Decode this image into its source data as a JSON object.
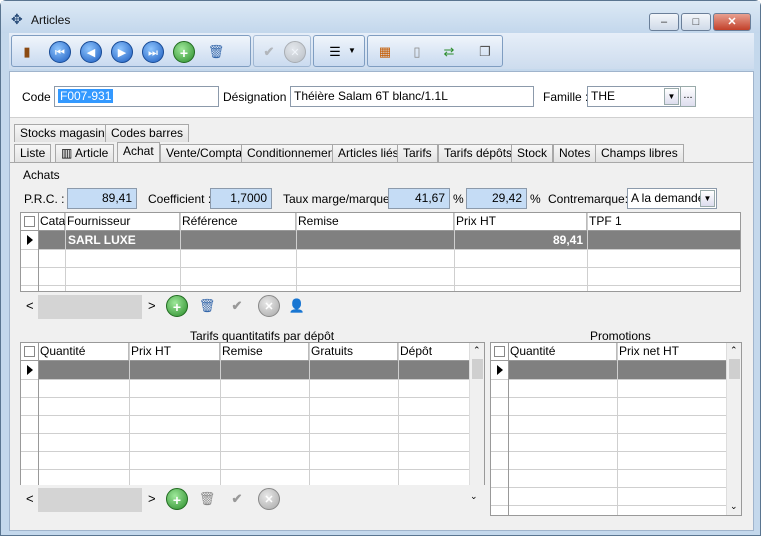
{
  "window": {
    "title": "Articles",
    "app_icon": "articles-app-icon"
  },
  "toolbar": {
    "icons": [
      "exit-door-icon",
      "first-record-icon",
      "previous-record-icon",
      "next-record-icon",
      "last-record-icon",
      "add-icon",
      "delete-icon",
      "validate-icon",
      "cancel-icon",
      "print-menu-icon",
      "stock-icon",
      "document-icon",
      "refresh-icon",
      "copy-icon"
    ]
  },
  "header": {
    "code_label": "Code :",
    "code_value": "F007-931",
    "designation_label": "Désignation :",
    "designation_value": "Théière Salam 6T blanc/1.1L",
    "famille_label": "Famille :",
    "famille_value": "THE",
    "more_button": "..."
  },
  "tabs_row1": [
    "Stocks magasins",
    "Codes barres"
  ],
  "tabs_row2": [
    "Liste",
    "Article",
    "Achat",
    "Vente/Compta",
    "Conditionnement",
    "Articles liés",
    "Tarifs",
    "Tarifs dépôts",
    "Stock",
    "Notes",
    "Champs libres"
  ],
  "active_tab": "Achat",
  "achats": {
    "group_label": "Achats",
    "prc_label": "P.R.C. :",
    "prc_value": "89,41",
    "coef_label": "Coefficient :",
    "coef_value": "1,7000",
    "taux_label": "Taux marge/marque :",
    "taux_marge_value": "41,67",
    "taux_marque_value": "29,42",
    "percent": "%",
    "contremarque_label": "Contremarque:",
    "contremarque_value": "A la demande"
  },
  "suppliers_grid": {
    "columns": [
      "Cata",
      "Fournisseur",
      "Référence",
      "Remise",
      "Prix HT",
      "TPF 1"
    ],
    "rows": [
      {
        "fournisseur": "SARL LUXE",
        "prix_ht": "89,41"
      }
    ]
  },
  "tarifs_grid": {
    "title": "Tarifs quantitatifs par dépôt",
    "columns": [
      "Quantité",
      "Prix HT",
      "Remise",
      "Gratuits",
      "Dépôt"
    ]
  },
  "promotions_grid": {
    "title": "Promotions",
    "columns": [
      "Quantité",
      "Prix net HT"
    ]
  },
  "nav": {
    "prev": "<",
    "next": ">"
  }
}
